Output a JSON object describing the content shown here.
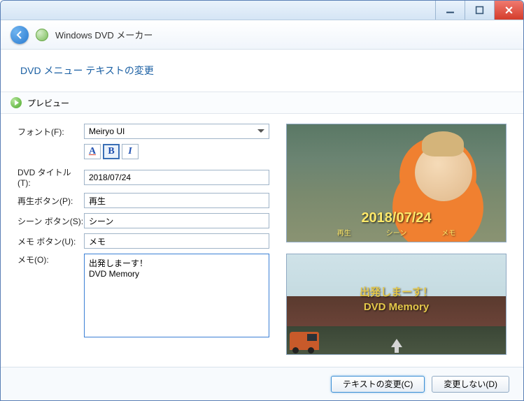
{
  "titlebar": {
    "minimize": "_",
    "maximize": "□",
    "close": "×"
  },
  "header": {
    "app_title": "Windows DVD メーカー"
  },
  "sub_header": {
    "title": "DVD メニュー テキストの変更"
  },
  "preview_bar": {
    "label": "プレビュー"
  },
  "form": {
    "font_label": "フォント(F):",
    "font_value": "Meiryo UI",
    "style_color": "A",
    "style_bold": "B",
    "style_italic": "I",
    "dvd_title_label": "DVD タイトル(T):",
    "dvd_title_value": "2018/07/24",
    "play_button_label": "再生ボタン(P):",
    "play_button_value": "再生",
    "scene_button_label": "シーン ボタン(S):",
    "scene_button_value": "シーン",
    "memo_button_label": "メモ ボタン(U):",
    "memo_button_value": "メモ",
    "memo_label": "メモ(O):",
    "memo_value": "出発しまーす！\nDVD Memory"
  },
  "preview1": {
    "date": "2018/07/24",
    "menu_play": "再生",
    "menu_scene": "シーン",
    "menu_memo": "メモ"
  },
  "preview2": {
    "line1": "出発しまーす！",
    "line2": "DVD Memory"
  },
  "footer": {
    "change_text": "テキストの変更(C)",
    "no_change": "変更しない(D)"
  }
}
